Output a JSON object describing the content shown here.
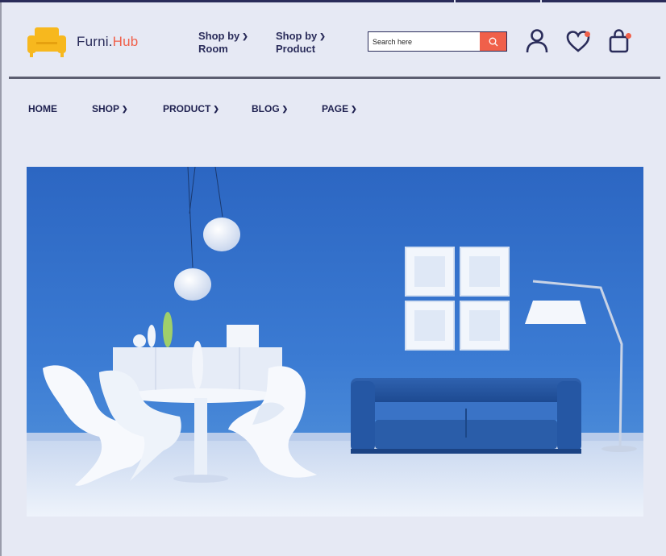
{
  "brand": {
    "name_part1": "Furni.",
    "name_part2": "Hub"
  },
  "shop_by": [
    {
      "line1": "Shop by",
      "line2": "Room"
    },
    {
      "line1": "Shop by",
      "line2": "Product"
    }
  ],
  "search": {
    "placeholder": "Search here"
  },
  "header_icons": [
    "user-icon",
    "heart-icon",
    "shopping-bag-icon"
  ],
  "nav": [
    {
      "label": "HOME",
      "has_dropdown": false
    },
    {
      "label": "SHOP",
      "has_dropdown": true
    },
    {
      "label": "PRODUCT",
      "has_dropdown": true
    },
    {
      "label": "BLOG",
      "has_dropdown": true
    },
    {
      "label": "PAGE",
      "has_dropdown": true
    }
  ],
  "colors": {
    "accent": "#f0604a",
    "navy": "#2a2c5a",
    "background": "#e6e9f4",
    "logo": "#f7b81e",
    "hero_wall": "#2f6ec8"
  }
}
